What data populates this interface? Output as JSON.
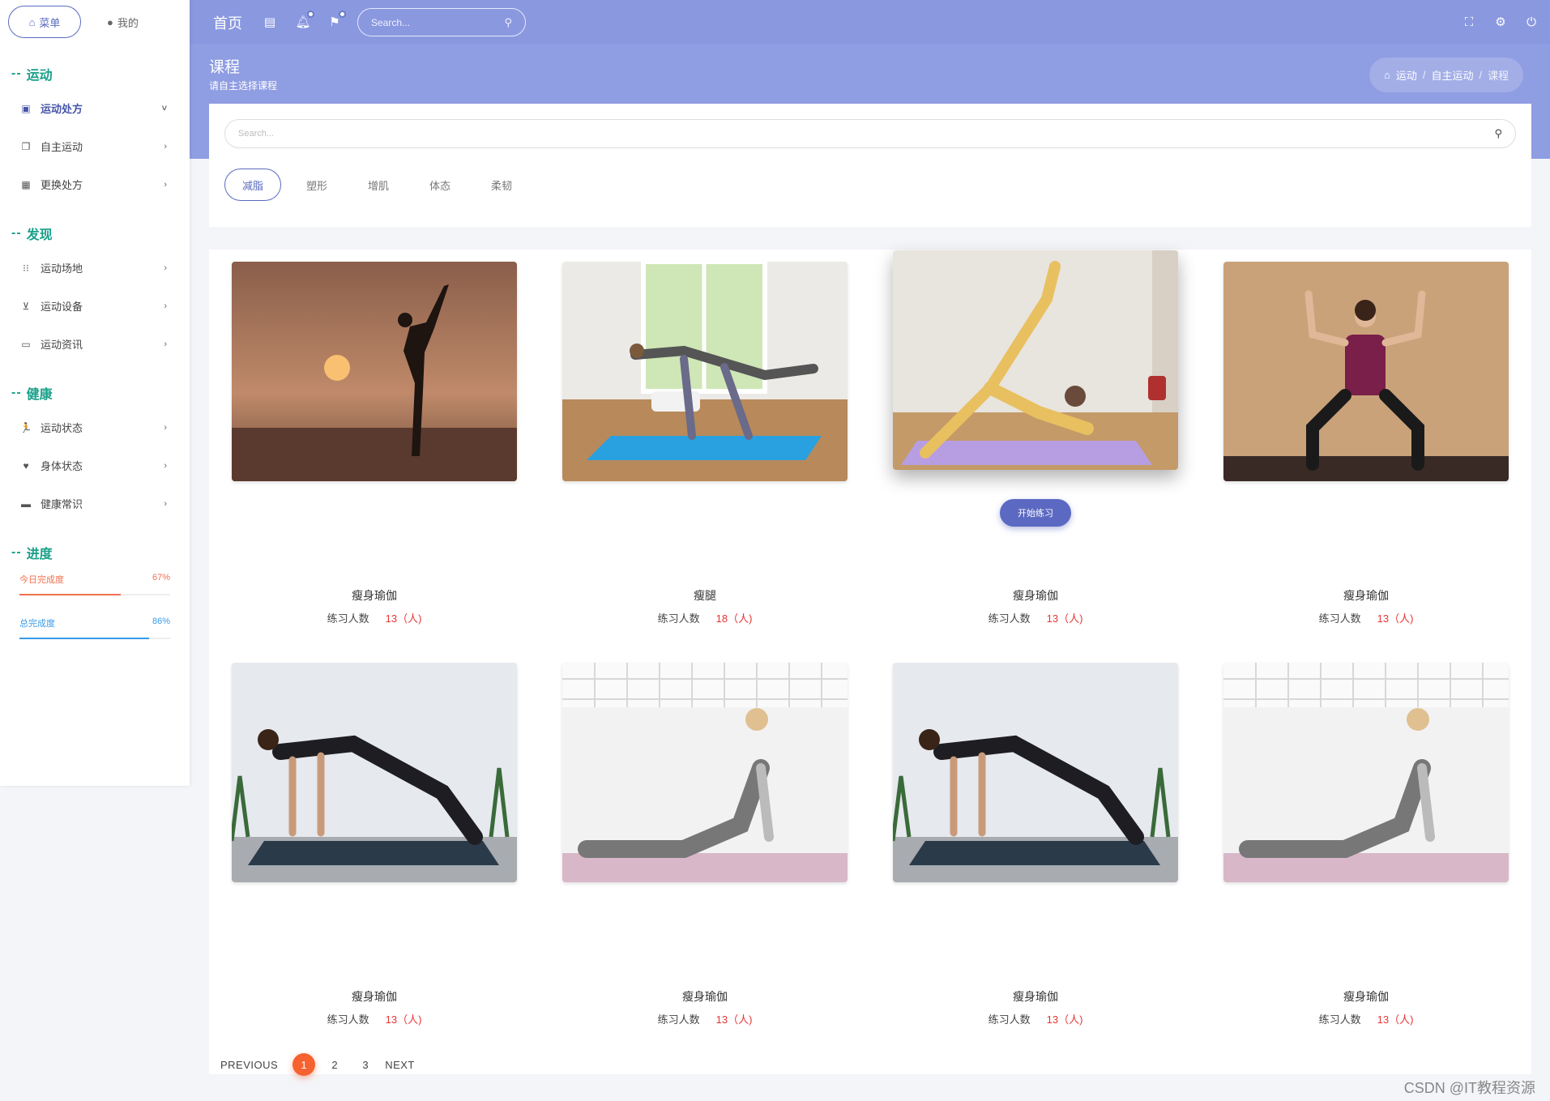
{
  "sidebar": {
    "tabs": [
      {
        "label": "菜单",
        "icon": "home-icon"
      },
      {
        "label": "我的",
        "icon": "user-icon"
      }
    ],
    "sections": [
      {
        "title": "运动",
        "items": [
          {
            "label": "运动处方",
            "icon": "clipboard-icon",
            "chevron": "˅"
          },
          {
            "label": "自主运动",
            "icon": "copy-icon",
            "chevron": "›"
          },
          {
            "label": "更换处方",
            "icon": "calendar-icon",
            "chevron": "›"
          }
        ]
      },
      {
        "title": "发现",
        "items": [
          {
            "label": "运动场地",
            "icon": "grid-icon",
            "chevron": "›"
          },
          {
            "label": "运动设备",
            "icon": "cart-icon",
            "chevron": "›"
          },
          {
            "label": "运动资讯",
            "icon": "monitor-icon",
            "chevron": "›"
          }
        ]
      },
      {
        "title": "健康",
        "items": [
          {
            "label": "运动状态",
            "icon": "running-icon",
            "chevron": "›"
          },
          {
            "label": "身体状态",
            "icon": "heart-icon",
            "chevron": "›"
          },
          {
            "label": "健康常识",
            "icon": "book-icon",
            "chevron": "›"
          }
        ]
      }
    ],
    "progress_title": "进度",
    "progress": [
      {
        "label": "今日完成度",
        "value_text": "67%",
        "value": 0.67,
        "color": "#f07050"
      },
      {
        "label": "总完成度",
        "value_text": "86%",
        "value": 0.86,
        "color": "#3a9ae8"
      }
    ]
  },
  "topnav": {
    "home": "首页",
    "search_placeholder": "Search..."
  },
  "page": {
    "title": "课程",
    "subtitle": "请自主选择课程",
    "breadcrumb": [
      "运动",
      "自主运动",
      "课程"
    ]
  },
  "filter": {
    "search_placeholder": "Search...",
    "tabs": [
      "减脂",
      "塑形",
      "增肌",
      "体态",
      "柔韧"
    ]
  },
  "courses": [
    {
      "title": "瘦身瑜伽",
      "meta_label": "练习人数",
      "count": "13（人)"
    },
    {
      "title": "瘦腿",
      "meta_label": "练习人数",
      "count": "18（人)"
    },
    {
      "title": "瘦身瑜伽",
      "meta_label": "练习人数",
      "count": "13（人)",
      "button": "开始练习"
    },
    {
      "title": "瘦身瑜伽",
      "meta_label": "练习人数",
      "count": "13（人)"
    },
    {
      "title": "瘦身瑜伽",
      "meta_label": "练习人数",
      "count": "13（人)"
    },
    {
      "title": "瘦身瑜伽",
      "meta_label": "练习人数",
      "count": "13（人)"
    },
    {
      "title": "瘦身瑜伽",
      "meta_label": "练习人数",
      "count": "13（人)"
    },
    {
      "title": "瘦身瑜伽",
      "meta_label": "练习人数",
      "count": "13（人)"
    }
  ],
  "pagination": {
    "prev": "PREVIOUS",
    "pages": [
      "1",
      "2",
      "3"
    ],
    "current": "1",
    "next": "NEXT"
  },
  "watermark": "CSDN @IT教程资源",
  "colors": {
    "header": "#8a98e0",
    "accent": "#5a6bbf",
    "section_title": "#1aa08a",
    "count": "#e83434",
    "page_active": "#f5622f"
  }
}
